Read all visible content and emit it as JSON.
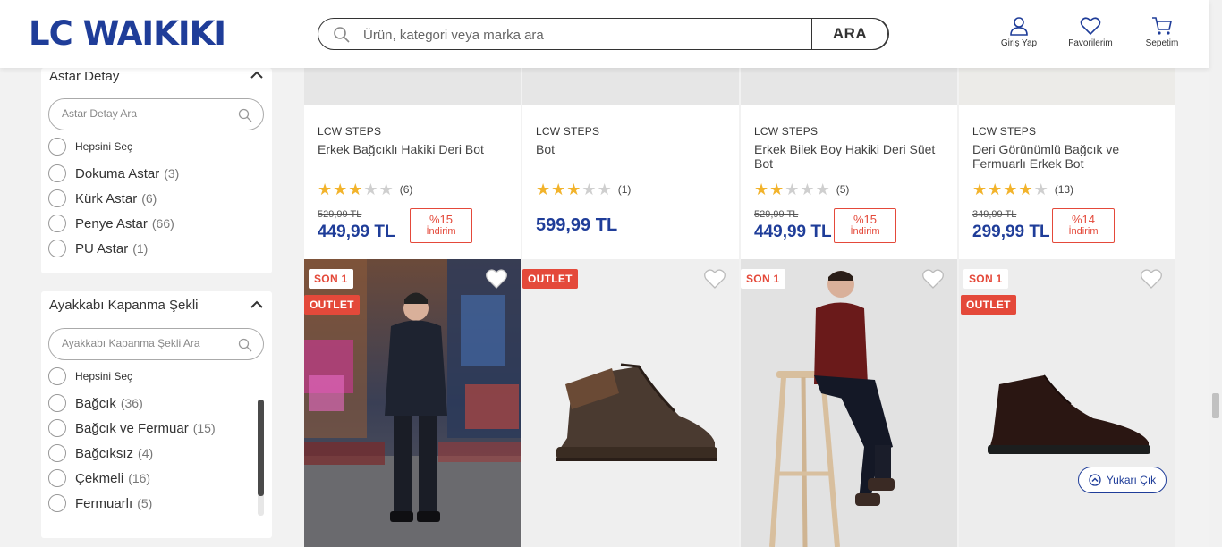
{
  "header": {
    "logo": "LC WAIKIKI",
    "search_placeholder": "Ürün, kategori veya marka ara",
    "search_button": "ARA",
    "login": "Giriş Yap",
    "favorites": "Favorilerim",
    "cart": "Sepetim"
  },
  "filters": {
    "astar": {
      "title": "Astar Detay",
      "search_placeholder": "Astar Detay Ara",
      "select_all": "Hepsini Seç",
      "options": [
        {
          "label": "Dokuma Astar",
          "count": "(3)"
        },
        {
          "label": "Kürk Astar",
          "count": "(6)"
        },
        {
          "label": "Penye Astar",
          "count": "(66)"
        },
        {
          "label": "PU Astar",
          "count": "(1)"
        }
      ]
    },
    "kapanma": {
      "title": "Ayakkabı Kapanma Şekli",
      "search_placeholder": "Ayakkabı Kapanma Şekli Ara",
      "select_all": "Hepsini Seç",
      "options": [
        {
          "label": "Bağcık",
          "count": "(36)"
        },
        {
          "label": "Bağcık ve Fermuar",
          "count": "(15)"
        },
        {
          "label": "Bağcıksız",
          "count": "(4)"
        },
        {
          "label": "Çekmeli",
          "count": "(16)"
        },
        {
          "label": "Fermuarlı",
          "count": "(5)"
        }
      ]
    }
  },
  "products": [
    {
      "brand": "LCW STEPS",
      "name": "Erkek Bağcıklı Hakiki Deri Bot",
      "rating": 3,
      "reviews": "(6)",
      "old_price": "529,99 TL",
      "price": "449,99 TL",
      "discount": "%15",
      "discount_label": "İndirim"
    },
    {
      "brand": "LCW STEPS",
      "name": "Bot",
      "rating": 3,
      "reviews": "(1)",
      "old_price": "",
      "price": "599,99 TL",
      "discount": "",
      "discount_label": ""
    },
    {
      "brand": "LCW STEPS",
      "name": "Erkek Bilek Boy Hakiki Deri Süet Bot",
      "rating": 2,
      "reviews": "(5)",
      "old_price": "529,99 TL",
      "price": "449,99 TL",
      "discount": "%15",
      "discount_label": "İndirim"
    },
    {
      "brand": "LCW STEPS",
      "name": "Deri Görünümlü Bağcık ve Fermuarlı Erkek Bot",
      "rating": 4,
      "reviews": "(13)",
      "old_price": "349,99 TL",
      "price": "299,99 TL",
      "discount": "%14",
      "discount_label": "İndirim"
    }
  ],
  "second_row": [
    {
      "badges": [
        "SON 1",
        "OUTLET"
      ]
    },
    {
      "badges": [
        "OUTLET"
      ]
    },
    {
      "badges": [
        "SON 1"
      ]
    },
    {
      "badges": [
        "SON 1",
        "OUTLET"
      ]
    }
  ],
  "scroll_top_button": "Yukarı Çık",
  "colors": {
    "brand": "#1f3d99",
    "sale": "#e4493a",
    "star": "#f2b32b"
  }
}
